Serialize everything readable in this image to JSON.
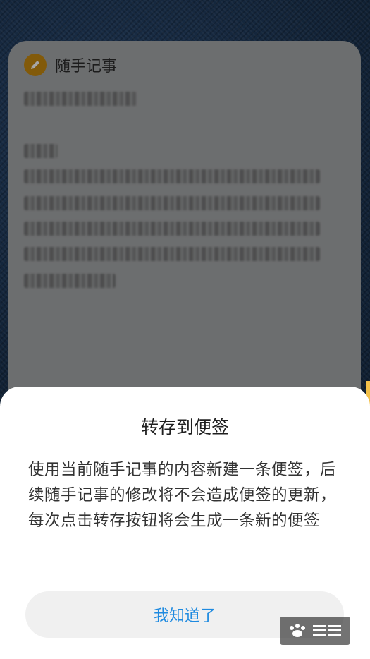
{
  "note_card": {
    "app_title": "随手记事",
    "icon": "pencil-icon",
    "accent_color": "#c88a10"
  },
  "dialog": {
    "title": "转存到便签",
    "message": "使用当前随手记事的内容新建一条便签，后续随手记事的修改将不会造成便签的更新，每次点击转存按钮将会生成一条新的便签",
    "confirm_label": "我知道了",
    "confirm_color": "#1e8ae0"
  },
  "watermark": {
    "logo": "baidu-jingyan-logo"
  }
}
